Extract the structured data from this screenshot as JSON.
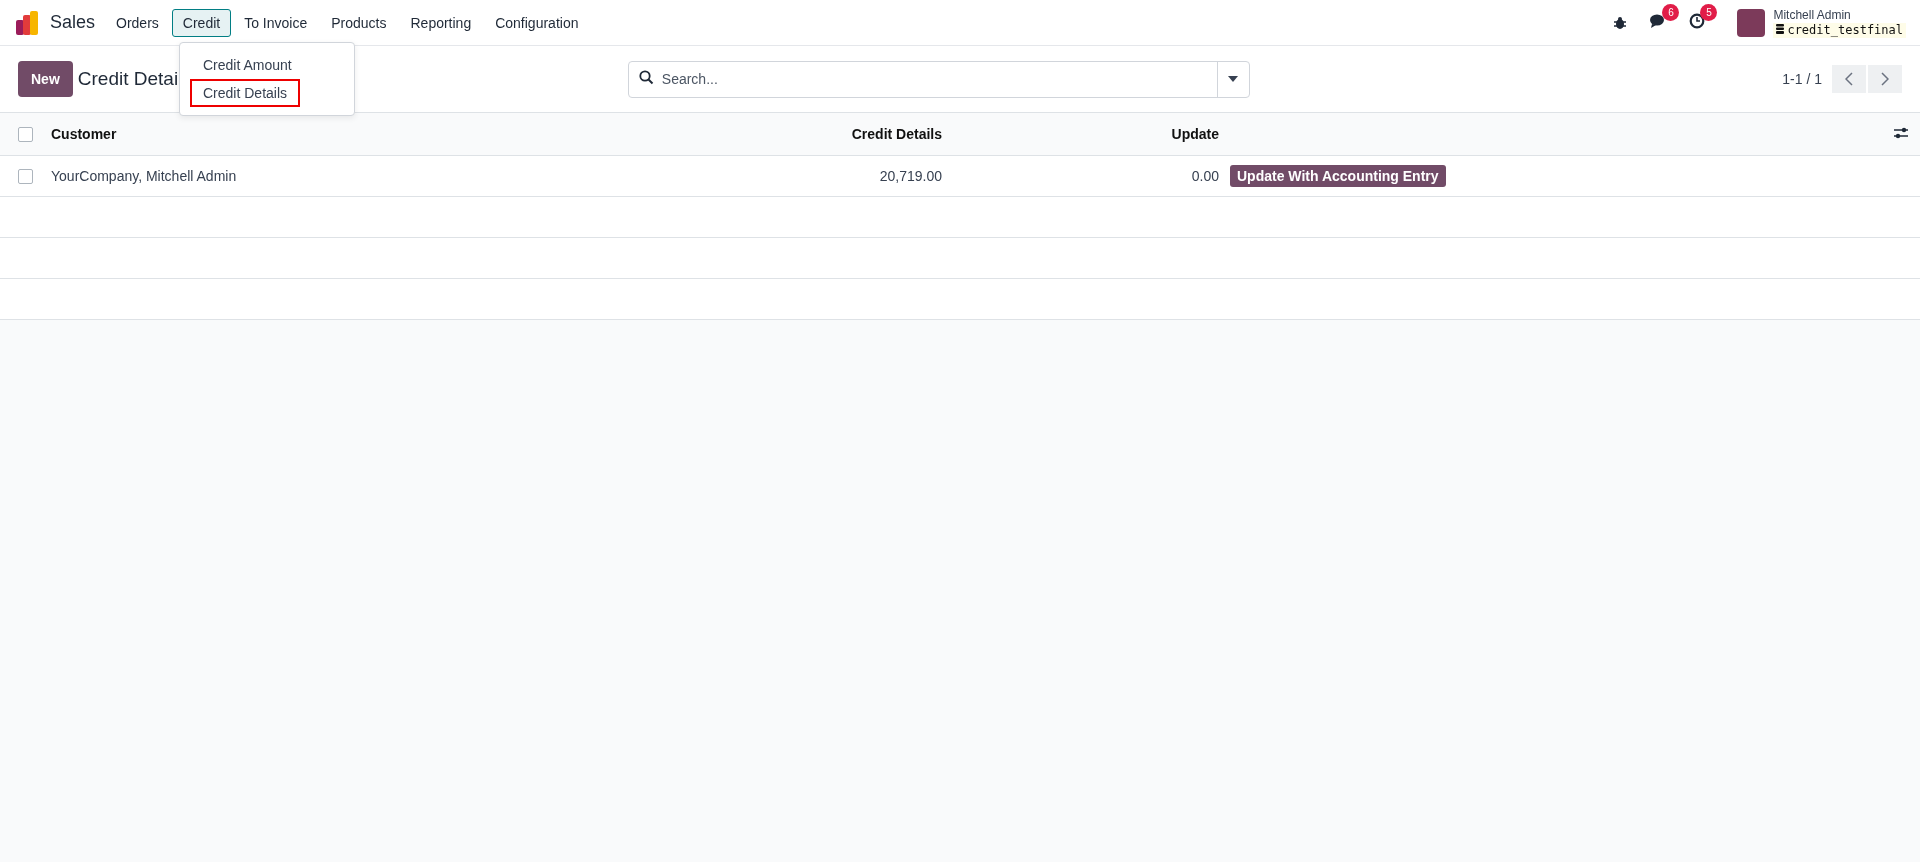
{
  "navbar": {
    "app_name": "Sales",
    "menu": [
      {
        "label": "Orders",
        "selected": false
      },
      {
        "label": "Credit",
        "selected": true
      },
      {
        "label": "To Invoice",
        "selected": false
      },
      {
        "label": "Products",
        "selected": false
      },
      {
        "label": "Reporting",
        "selected": false
      },
      {
        "label": "Configuration",
        "selected": false
      }
    ],
    "messages_count": "6",
    "activities_count": "5",
    "user_name": "Mitchell Admin",
    "database": "credit_testfinal"
  },
  "dropdown": {
    "items": [
      {
        "label": "Credit Amount",
        "highlighted": false
      },
      {
        "label": "Credit Details",
        "highlighted": true
      }
    ]
  },
  "control_panel": {
    "new_button": "New",
    "title": "Credit Detai",
    "search": {
      "placeholder": "Search..."
    },
    "pager": "1-1 / 1"
  },
  "table": {
    "select_all": {
      "checked": false
    },
    "columns": [
      "Customer",
      "Credit Details",
      "Update"
    ],
    "rows": [
      {
        "selected": false,
        "customer": "YourCompany, Mitchell Admin",
        "credit_details": "20,719.00",
        "update": "0.00",
        "action": "Update With Accounting Entry"
      }
    ]
  }
}
